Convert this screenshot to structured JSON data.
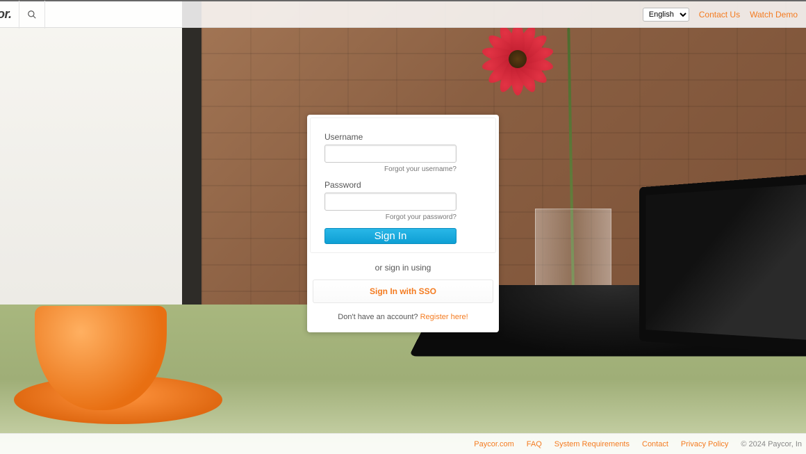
{
  "brand": "or.",
  "topbar": {
    "language_options": [
      "English"
    ],
    "language_selected": "English",
    "links": {
      "contact": "Contact Us",
      "demo": "Watch Demo"
    }
  },
  "login": {
    "username_label": "Username",
    "username_value": "",
    "forgot_username": "Forgot your username?",
    "password_label": "Password",
    "password_value": "",
    "forgot_password": "Forgot your password?",
    "signin_label": "Sign In",
    "or_text": "or sign in using",
    "sso_label": "Sign In with SSO",
    "no_account_text": "Don't have an account? ",
    "register_link": "Register here!"
  },
  "footer": {
    "links": [
      "Paycor.com",
      "FAQ",
      "System Requirements",
      "Contact",
      "Privacy Policy"
    ],
    "copyright": "© 2024 Paycor, In"
  },
  "colors": {
    "accent": "#f47b20",
    "primary_btn": "#1aaad9"
  }
}
